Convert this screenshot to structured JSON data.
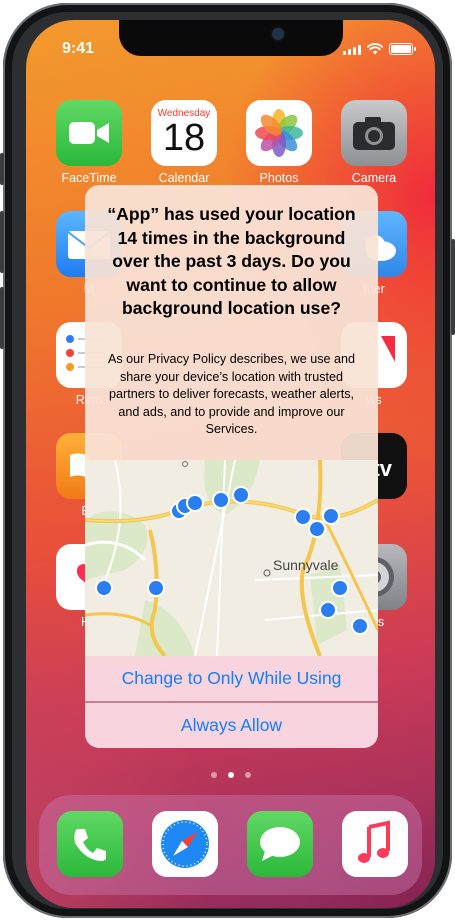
{
  "status_bar": {
    "time": "9:41"
  },
  "home_apps": {
    "facetime": "FaceTime",
    "calendar": "Calendar",
    "calendar_day_name": "Wednesday",
    "calendar_date": "18",
    "photos": "Photos",
    "camera": "Camera",
    "mail_partial": "M",
    "weather_partial": "ther",
    "reminders_partial": "Rem",
    "news_partial": "ws",
    "books_partial": "Bo",
    "health_partial": "He",
    "settings_partial": "ngs"
  },
  "alert": {
    "title": "“App” has used your location 14 times in the background over the past 3 days. Do you want to continue to allow background location use?",
    "message": "As our Privacy Policy describes, we use and share your device’s location with trusted partners to deliver forecasts, weather alerts, and ads, and to provide and improve our Services.",
    "map_label": "Sunnyvale",
    "location_points_count": 14,
    "button_primary": "Change to Only While Using",
    "button_secondary": "Always Allow",
    "button_color": "#147efb"
  },
  "page_indicator": {
    "pages": 3,
    "current": 2
  },
  "dock": [
    "phone-icon",
    "safari-icon",
    "messages-icon",
    "music-icon"
  ]
}
